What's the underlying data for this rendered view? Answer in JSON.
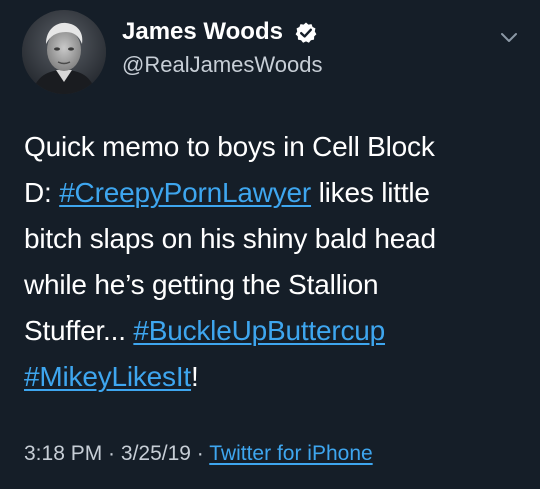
{
  "author": {
    "display_name": "James Woods",
    "handle": "@RealJamesWoods",
    "verified": true
  },
  "tweet": {
    "line1": "Quick memo to boys in Cell Block",
    "line2_prefix": "D: ",
    "hashtag1": "#CreepyPornLawyer",
    "line2_suffix": " likes little",
    "line3": "bitch slaps on his shiny bald head",
    "line4": "while he’s getting the Stallion",
    "line5_prefix": "Stuffer... ",
    "hashtag2": "#BuckleUpButtercup",
    "hashtag3": "#MikeyLikesIt",
    "line6_suffix": "!"
  },
  "meta": {
    "time": "3:18 PM",
    "separator1": " · ",
    "date": "3/25/19",
    "separator2": " · ",
    "source": "Twitter for iPhone"
  },
  "icons": {
    "verified": "verified-badge-icon",
    "menu": "chevron-down-icon"
  },
  "colors": {
    "background": "#151e28",
    "link": "#3ea6ef",
    "verified": "#ffffff"
  }
}
